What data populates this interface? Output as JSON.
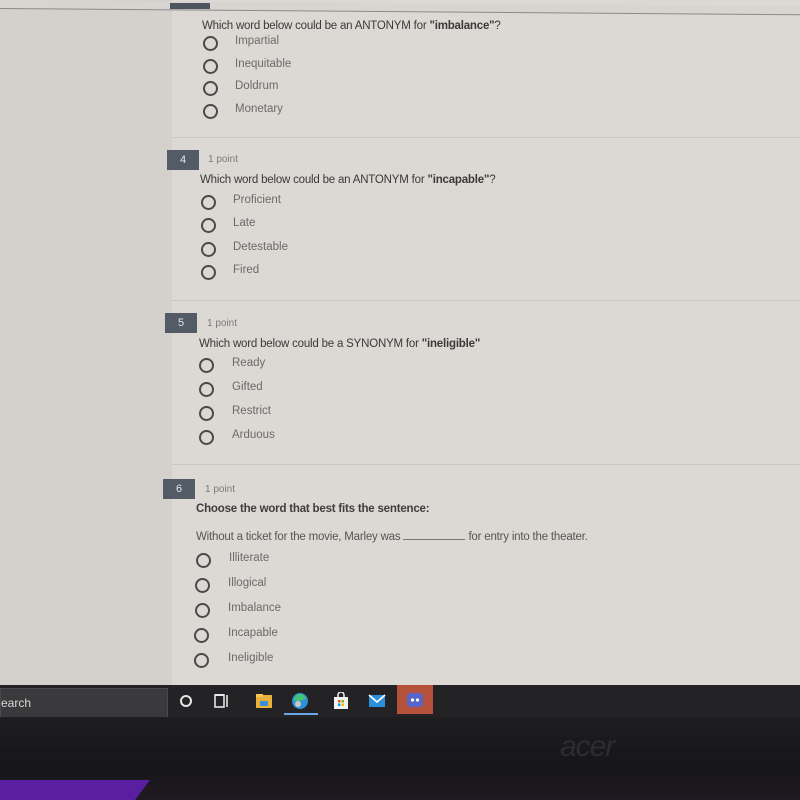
{
  "quiz": {
    "questions": [
      {
        "number": "",
        "points": "",
        "prompt_prefix": "Which word below could be an ANTONYM for ",
        "prompt_term": "\"imbalance\"",
        "prompt_suffix": "?",
        "options": [
          "Impartial",
          "Inequitable",
          "Doldrum",
          "Monetary"
        ]
      },
      {
        "number": "4",
        "points": "1 point",
        "prompt_prefix": "Which word below could be an ANTONYM for ",
        "prompt_term": "\"incapable\"",
        "prompt_suffix": "?",
        "options": [
          "Proficient",
          "Late",
          "Detestable",
          "Fired"
        ]
      },
      {
        "number": "5",
        "points": "1 point",
        "prompt_prefix": "Which word below could be a SYNONYM for ",
        "prompt_term": "\"ineligible\"",
        "prompt_suffix": "",
        "options": [
          "Ready",
          "Gifted",
          "Restrict",
          "Arduous"
        ]
      },
      {
        "number": "6",
        "points": "1 point",
        "prompt": "Choose the word that best fits the sentence:",
        "sentence_before": "Without a ticket for the movie, Marley was",
        "sentence_after": "for entry into the theater.",
        "options": [
          "Illiterate",
          "Illogical",
          "Imbalance",
          "Incapable",
          "Ineligible"
        ]
      }
    ]
  },
  "taskbar": {
    "search_text": "earch",
    "icons": [
      "cortana-icon",
      "task-view-icon",
      "file-explorer-icon",
      "edge-icon",
      "store-icon",
      "mail-icon",
      "discord-icon"
    ]
  },
  "monitor": {
    "brand": "acer"
  },
  "colors": {
    "question_badge": "#535b66",
    "page_bg": "#dcd9d4",
    "taskbar": "#232325",
    "discord_active": "#b5513a",
    "edge_underline": "#6aa6e6"
  }
}
